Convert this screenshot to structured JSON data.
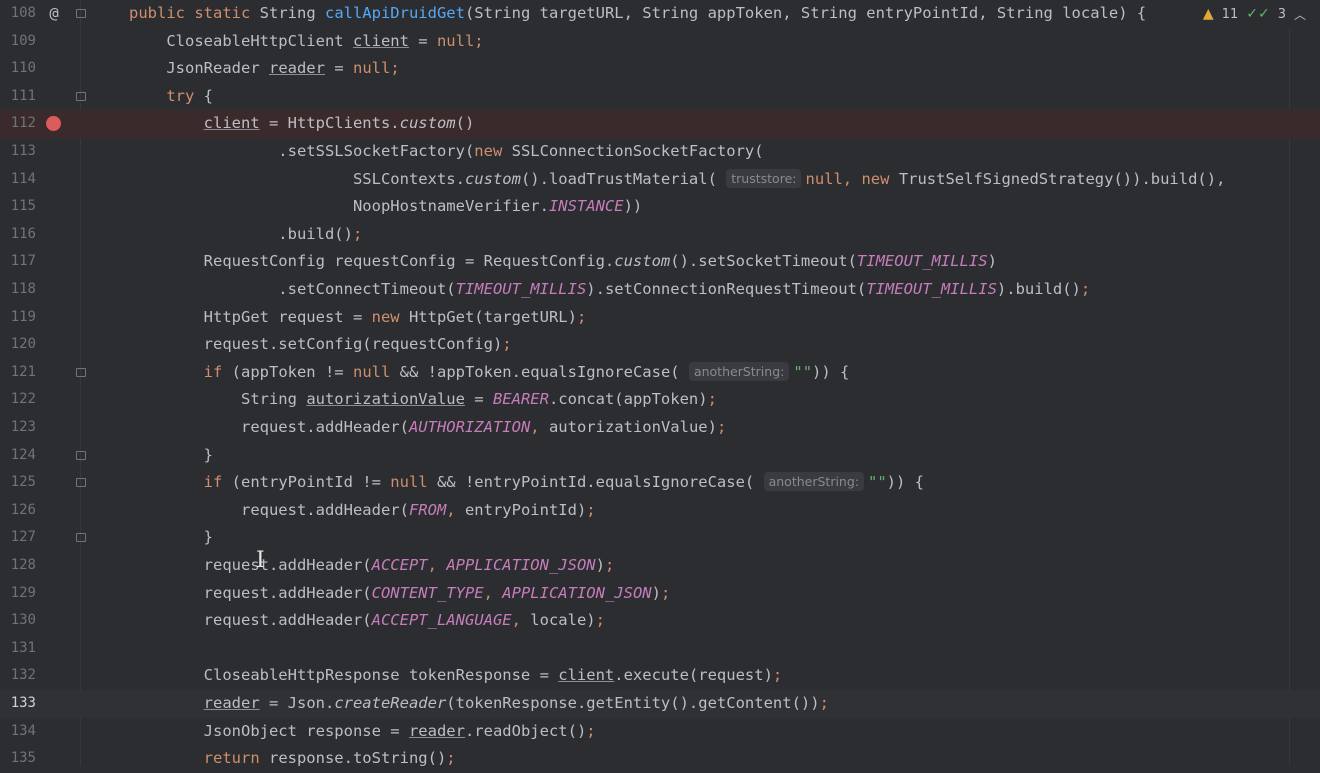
{
  "inspection": {
    "warnings_count": "11",
    "ok_count": "3",
    "warn_icon": "warning-triangle-icon",
    "ok_icon": "double-check-icon",
    "expand_icon": "chevron-up-icon"
  },
  "gutter": {
    "override_marker": "@",
    "breakpoint_line": "112",
    "current_line": "133"
  },
  "colors": {
    "background": "#2b2d30",
    "keyword": "#cf8e6d",
    "method_decl": "#56a8f5",
    "constant": "#c77dbb",
    "string": "#6aab73",
    "breakpoint": "#db5c5c"
  },
  "lines": [
    {
      "n": "108",
      "html": "<span class=\"kw\">public static </span>String <span class=\"fn\">callApiDruidGet</span>(String targetURL, String appToken, String entryPointId, String locale) {"
    },
    {
      "n": "109",
      "html": "    CloseableHttpClient <span class=\"underline\">client</span> = <span class=\"kw\">null</span><span class=\"semi\">;</span>"
    },
    {
      "n": "110",
      "html": "    JsonReader <span class=\"underline\">reader</span> = <span class=\"kw\">null</span><span class=\"semi\">;</span>"
    },
    {
      "n": "111",
      "html": "    <span class=\"kw\">try </span>{"
    },
    {
      "n": "112",
      "html": "        <span class=\"underline\">client</span> = HttpClients.<span class=\"italic\">custom</span>()"
    },
    {
      "n": "113",
      "html": "                .setSSLSocketFactory(<span class=\"kw\">new </span>SSLConnectionSocketFactory("
    },
    {
      "n": "114",
      "html": "                        SSLContexts.<span class=\"italic\">custom</span>().loadTrustMaterial( <span class=\"hint\">truststore:</span><span class=\"kw\">null, new </span>TrustSelfSignedStrategy()).build(),"
    },
    {
      "n": "115",
      "html": "                        NoopHostnameVerifier.<span class=\"const\">INSTANCE</span>))"
    },
    {
      "n": "116",
      "html": "                .build()<span class=\"semi\">;</span>"
    },
    {
      "n": "117",
      "html": "        RequestConfig requestConfig = RequestConfig.<span class=\"italic\">custom</span>().setSocketTimeout(<span class=\"const\">TIMEOUT_MILLIS</span>)"
    },
    {
      "n": "118",
      "html": "                .setConnectTimeout(<span class=\"const\">TIMEOUT_MILLIS</span>).setConnectionRequestTimeout(<span class=\"const\">TIMEOUT_MILLIS</span>).build()<span class=\"semi\">;</span>"
    },
    {
      "n": "119",
      "html": "        HttpGet request = <span class=\"kw\">new </span>HttpGet(targetURL)<span class=\"semi\">;</span>"
    },
    {
      "n": "120",
      "html": "        request.setConfig(requestConfig)<span class=\"semi\">;</span>"
    },
    {
      "n": "121",
      "html": "        <span class=\"kw\">if </span>(appToken != <span class=\"kw\">null </span>&amp;&amp; !appToken.equalsIgnoreCase( <span class=\"hint\">anotherString:</span><span class=\"str\">\"\"</span>)) {"
    },
    {
      "n": "122",
      "html": "            String <span class=\"underline\">autorizationValue</span> = <span class=\"const\">BEARER</span>.concat(appToken)<span class=\"semi\">;</span>"
    },
    {
      "n": "123",
      "html": "            request.addHeader(<span class=\"const\">AUTHORIZATION</span><span class=\"semi\">, </span>autorizationValue)<span class=\"semi\">;</span>"
    },
    {
      "n": "124",
      "html": "        }"
    },
    {
      "n": "125",
      "html": "        <span class=\"kw\">if </span>(entryPointId != <span class=\"kw\">null </span>&amp;&amp; !entryPointId.equalsIgnoreCase( <span class=\"hint\">anotherString:</span><span class=\"str\">\"\"</span>)) {"
    },
    {
      "n": "126",
      "html": "            request.addHeader(<span class=\"const\">FROM</span><span class=\"semi\">, </span>entryPointId)<span class=\"semi\">;</span>"
    },
    {
      "n": "127",
      "html": "        }"
    },
    {
      "n": "128",
      "html": "        request.addHeader(<span class=\"const\">ACCEPT</span><span class=\"semi\">, </span><span class=\"const\">APPLICATION_JSON</span>)<span class=\"semi\">;</span>"
    },
    {
      "n": "129",
      "html": "        request.addHeader(<span class=\"const\">CONTENT_TYPE</span><span class=\"semi\">, </span><span class=\"const\">APPLICATION_JSON</span>)<span class=\"semi\">;</span>"
    },
    {
      "n": "130",
      "html": "        request.addHeader(<span class=\"const\">ACCEPT_LANGUAGE</span><span class=\"semi\">, </span>locale)<span class=\"semi\">;</span>"
    },
    {
      "n": "131",
      "html": ""
    },
    {
      "n": "132",
      "html": "        CloseableHttpResponse tokenResponse = <span class=\"underline\">client</span>.execute(request)<span class=\"semi\">;</span>"
    },
    {
      "n": "133",
      "html": "        <span class=\"underline\">reader</span> = Json.<span class=\"italic\">createReader</span>(tokenResponse.getEntity().getContent())<span class=\"semi\">;</span>"
    },
    {
      "n": "134",
      "html": "        JsonObject response = <span class=\"underline\">reader</span>.readObject()<span class=\"semi\">;</span>"
    },
    {
      "n": "135",
      "html": "        <span class=\"kw\">return </span>response.toString()<span class=\"semi\">;</span>"
    }
  ]
}
